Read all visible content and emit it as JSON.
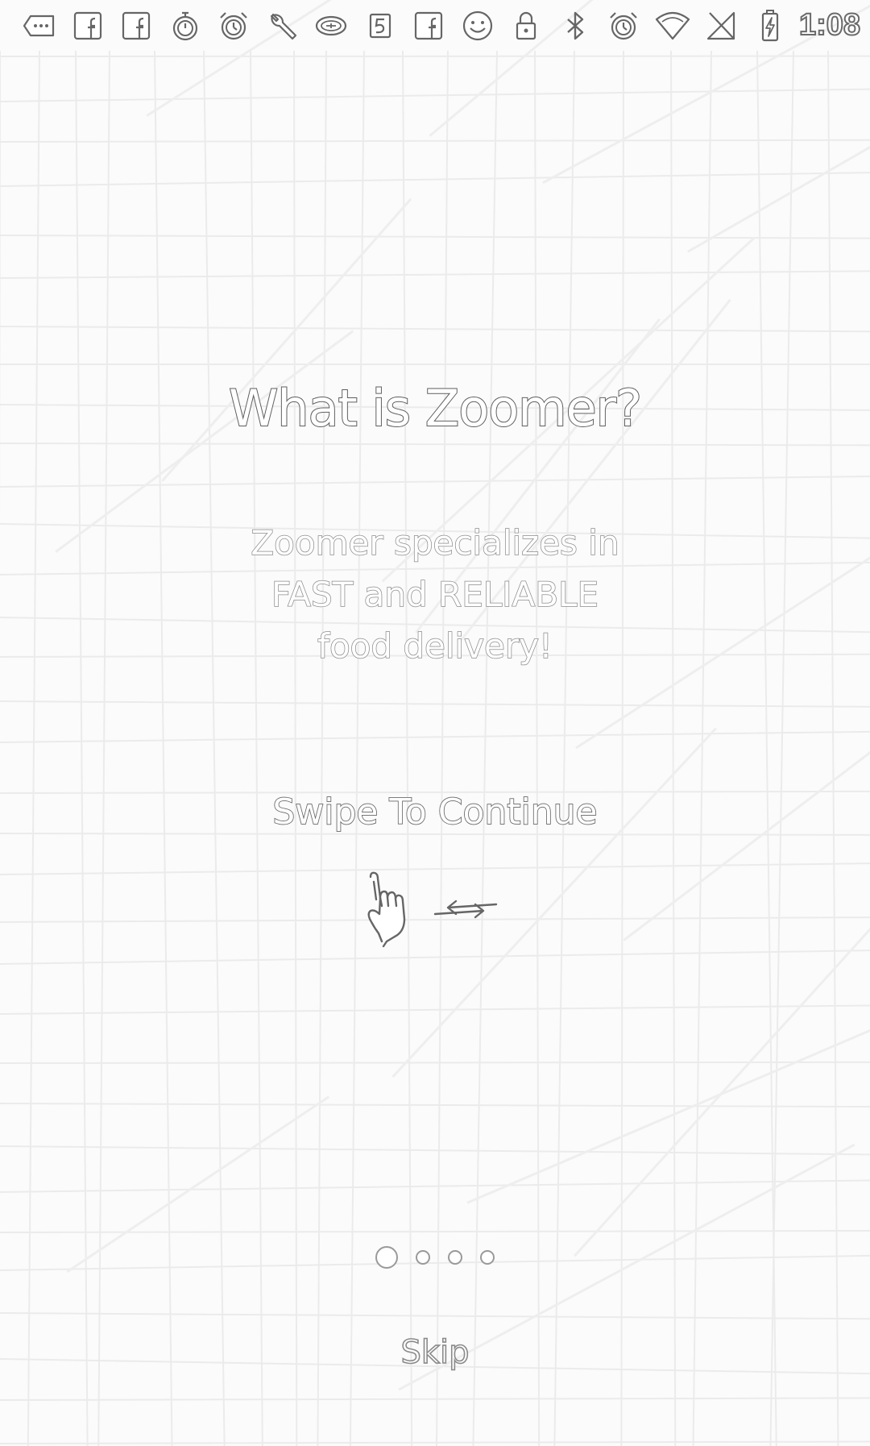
{
  "status_bar": {
    "time": "1:08",
    "icons": [
      "more-apps-icon",
      "facebook-icon",
      "facebook-icon",
      "stopwatch-icon",
      "alarm-icon",
      "wrench-icon",
      "game-controller-icon",
      "five-icon",
      "facebook-icon",
      "smiley-icon",
      "lock-icon",
      "bluetooth-icon",
      "alarm-icon",
      "wifi-icon",
      "no-sim-icon",
      "battery-charging-icon"
    ]
  },
  "onboarding": {
    "title": "What is Zoomer?",
    "description_lines": [
      "Zoomer specializes in",
      "FAST and RELIABLE",
      "food delivery!"
    ],
    "swipe_label": "Swipe To Continue",
    "gesture_icons": [
      "hand-pointer-icon",
      "swap-arrows-icon"
    ],
    "pager": {
      "current": 1,
      "total": 4
    },
    "skip_label": "Skip"
  },
  "colors": {
    "background": "#fbfbfb",
    "text_fill": "#ffffff",
    "text_outline": "#6e6e6e",
    "map_lines": "#ececec"
  }
}
